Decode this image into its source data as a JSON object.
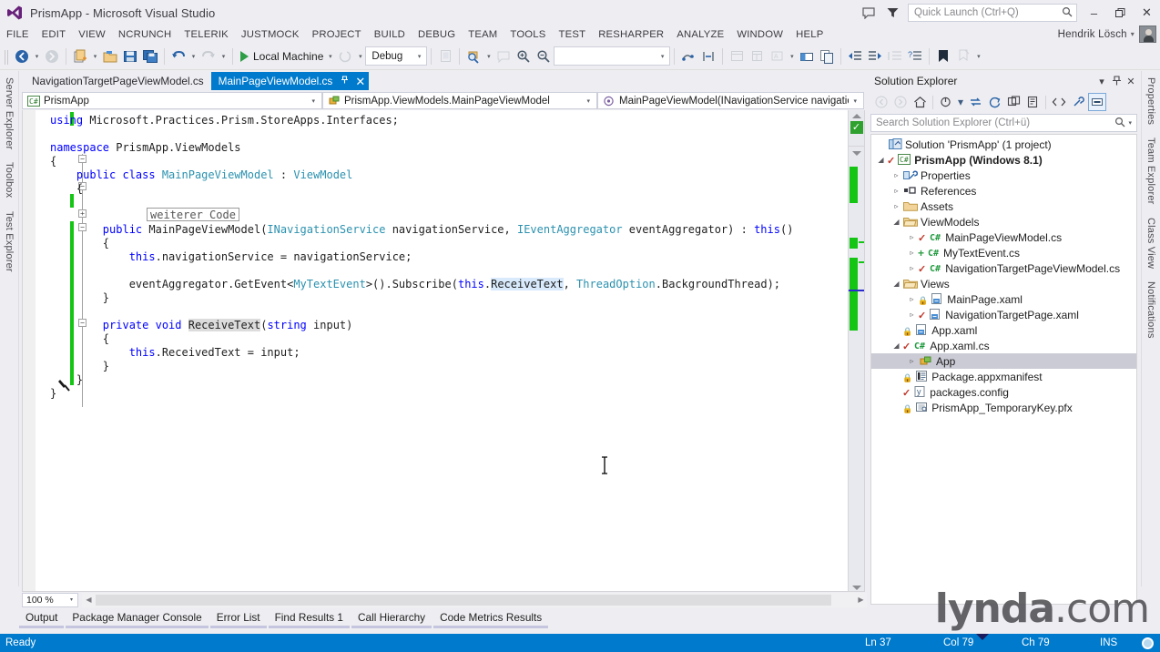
{
  "window": {
    "title": "PrismApp - Microsoft Visual Studio",
    "logo_icon": "visual-studio-logo",
    "minimize_label": "–",
    "maximize_label": "❐",
    "close_label": "✕",
    "feedback_icon": "feedback-icon",
    "filter_icon": "filter-icon"
  },
  "quick_launch": {
    "placeholder": "Quick Launch (Ctrl+Q)",
    "icon": "search-icon"
  },
  "menubar": {
    "items": [
      "FILE",
      "EDIT",
      "VIEW",
      "NCRUNCH",
      "TELERIK",
      "JUSTMOCK",
      "PROJECT",
      "BUILD",
      "DEBUG",
      "TEAM",
      "TOOLS",
      "TEST",
      "RESHARPER",
      "ANALYZE",
      "WINDOW",
      "HELP"
    ],
    "user_name": "Hendrik Lösch",
    "user_caret": "▾",
    "avatar_icon": "user-avatar"
  },
  "toolbar": {
    "navigate_back_icon": "navigate-back-icon",
    "navigate_forward_icon": "navigate-forward-icon",
    "new_project_icon": "new-project-icon",
    "open_file_icon": "open-file-icon",
    "save_icon": "save-icon",
    "save_all_icon": "save-all-icon",
    "undo_icon": "undo-icon",
    "redo_icon": "redo-icon",
    "start_label": "Local Machine",
    "start_icon": "run-play-icon",
    "stop_icon": "stop-icon",
    "config_value": "Debug",
    "find_icon": "find-icon",
    "zoom_in_icon": "zoom-in-icon",
    "zoom_out_icon": "zoom-out-icon",
    "blank_combo_value": "",
    "comment_icon": "comment-icon",
    "uncomment_icon": "uncomment-icon",
    "indent_icon": "indent-icon",
    "outdent_icon": "outdent-icon",
    "bookmark_icon": "bookmark-icon",
    "toolbox_icon": "toolbox-icon",
    "properties_window_icon": "properties-window-icon",
    "solution_explorer_icon": "solution-explorer-icon",
    "object_browser_icon": "object-browser-icon",
    "caret": "▾"
  },
  "left_dock": {
    "tabs": [
      "Server Explorer",
      "Toolbox",
      "Test Explorer"
    ]
  },
  "right_dock": {
    "tabs": [
      "Properties",
      "Team Explorer",
      "Class View",
      "Notifications"
    ]
  },
  "editor": {
    "tabs": [
      {
        "label": "NavigationTargetPageViewModel.cs",
        "active": false
      },
      {
        "label": "MainPageViewModel.cs",
        "active": true,
        "pin_icon": "pin-icon",
        "pin_glyph": "–❉",
        "close_glyph": "✕"
      }
    ],
    "navbar": {
      "project": "PrismApp",
      "project_icon": "csharp-project-icon",
      "type": "PrismApp.ViewModels.MainPageViewModel",
      "type_icon": "class-icon",
      "member": "MainPageViewModel(INavigationService navigationSer",
      "member_icon": "method-icon",
      "caret": "▾"
    },
    "outline_box_text": "weiterer Code",
    "zoom_level": "100 %",
    "zoom_caret": "▾",
    "code_lines": [
      {
        "indent": 0,
        "segments": [
          {
            "t": "using",
            "c": "k"
          },
          {
            "t": " Microsoft.Practices.Prism.StoreApps.Interfaces;",
            "c": "plain"
          }
        ]
      },
      {
        "indent": 0,
        "segments": []
      },
      {
        "indent": 0,
        "segments": [
          {
            "t": "namespace",
            "c": "k"
          },
          {
            "t": " PrismApp.ViewModels",
            "c": "plain"
          }
        ]
      },
      {
        "indent": 0,
        "segments": [
          {
            "t": "{",
            "c": "plain"
          }
        ]
      },
      {
        "indent": 1,
        "segments": [
          {
            "t": "public class ",
            "c": "k"
          },
          {
            "t": "MainPageViewModel",
            "c": "t"
          },
          {
            "t": " : ",
            "c": "plain"
          },
          {
            "t": "ViewModel",
            "c": "t"
          }
        ]
      },
      {
        "indent": 1,
        "segments": [
          {
            "t": "{",
            "c": "plain"
          }
        ]
      },
      {
        "indent": 2,
        "segments": []
      },
      {
        "indent": 2,
        "segments": []
      },
      {
        "indent": 2,
        "segments": [
          {
            "t": "public ",
            "c": "k"
          },
          {
            "t": "MainPageViewModel(",
            "c": "plain"
          },
          {
            "t": "INavigationService",
            "c": "t"
          },
          {
            "t": " navigationService, ",
            "c": "plain"
          },
          {
            "t": "IEventAggregator",
            "c": "t"
          },
          {
            "t": " eventAggregator) : ",
            "c": "plain"
          },
          {
            "t": "this",
            "c": "k"
          },
          {
            "t": "()",
            "c": "plain"
          }
        ]
      },
      {
        "indent": 2,
        "segments": [
          {
            "t": "{",
            "c": "plain"
          }
        ]
      },
      {
        "indent": 3,
        "segments": [
          {
            "t": "this",
            "c": "k"
          },
          {
            "t": ".navigationService = navigationService;",
            "c": "plain"
          }
        ]
      },
      {
        "indent": 3,
        "segments": []
      },
      {
        "indent": 3,
        "segments": [
          {
            "t": "eventAggregator.GetEvent<",
            "c": "plain"
          },
          {
            "t": "MyTextEvent",
            "c": "t"
          },
          {
            "t": ">().Subscribe(",
            "c": "plain"
          },
          {
            "t": "this",
            "c": "k"
          },
          {
            "t": ".",
            "c": "plain"
          },
          {
            "t": "ReceiveText",
            "c": "plain hl"
          },
          {
            "t": ", ",
            "c": "plain"
          },
          {
            "t": "ThreadOption",
            "c": "t"
          },
          {
            "t": ".BackgroundThread);",
            "c": "plain"
          }
        ]
      },
      {
        "indent": 2,
        "segments": [
          {
            "t": "}",
            "c": "plain"
          }
        ]
      },
      {
        "indent": 2,
        "segments": []
      },
      {
        "indent": 2,
        "segments": [
          {
            "t": "private void ",
            "c": "k"
          },
          {
            "t": "ReceiveText",
            "c": "plain hl2"
          },
          {
            "t": "(",
            "c": "plain"
          },
          {
            "t": "string",
            "c": "k"
          },
          {
            "t": " input)",
            "c": "plain"
          }
        ]
      },
      {
        "indent": 2,
        "segments": [
          {
            "t": "{",
            "c": "plain"
          }
        ]
      },
      {
        "indent": 3,
        "segments": [
          {
            "t": "this",
            "c": "k"
          },
          {
            "t": ".ReceivedText = input;",
            "c": "plain"
          }
        ]
      },
      {
        "indent": 2,
        "segments": [
          {
            "t": "}",
            "c": "plain"
          }
        ]
      },
      {
        "indent": 1,
        "segments": [
          {
            "t": "}",
            "c": "plain"
          }
        ]
      },
      {
        "indent": 0,
        "segments": [
          {
            "t": "}",
            "c": "plain"
          }
        ]
      }
    ]
  },
  "bottom_tabs": [
    "Output",
    "Package Manager Console",
    "Error List",
    "Find Results 1",
    "Call Hierarchy",
    "Code Metrics Results"
  ],
  "solution_explorer": {
    "title": "Solution Explorer",
    "dropdown_icon": "chevron-down-icon",
    "pin_icon": "pin-icon",
    "close_icon": "close-icon",
    "toolbar_icons": [
      "back-icon",
      "forward-icon",
      "home-icon",
      "pending-changes-icon",
      "sync-with-active-document-icon",
      "refresh-icon",
      "collapse-all-icon",
      "show-all-files-icon",
      "view-code-icon",
      "properties-icon",
      "preview-selected-items-icon"
    ],
    "search_placeholder": "Search Solution Explorer (Ctrl+ü)",
    "search_icon": "search-icon",
    "tree": [
      {
        "depth": 0,
        "expander": "",
        "icon": "solution-icon",
        "label": "Solution 'PrismApp' (1 project)",
        "bold": false,
        "status": "",
        "selected": false
      },
      {
        "depth": 0,
        "expander": "◢",
        "icon": "csharp-project-icon",
        "label": "PrismApp (Windows 8.1)",
        "bold": true,
        "status": "check",
        "selected": false
      },
      {
        "depth": 1,
        "expander": "▹",
        "icon": "properties-folder-icon",
        "label": "Properties",
        "bold": false,
        "status": "",
        "selected": false
      },
      {
        "depth": 1,
        "expander": "▹",
        "icon": "references-icon",
        "label": "References",
        "bold": false,
        "status": "",
        "selected": false
      },
      {
        "depth": 1,
        "expander": "▹",
        "icon": "folder-icon",
        "label": "Assets",
        "bold": false,
        "status": "",
        "selected": false
      },
      {
        "depth": 1,
        "expander": "◢",
        "icon": "folder-open-icon",
        "label": "ViewModels",
        "bold": false,
        "status": "",
        "selected": false
      },
      {
        "depth": 2,
        "expander": "▹",
        "icon": "csharp-file-icon",
        "label": "MainPageViewModel.cs",
        "bold": false,
        "status": "check",
        "selected": false
      },
      {
        "depth": 2,
        "expander": "▹",
        "icon": "csharp-file-icon",
        "label": "MyTextEvent.cs",
        "bold": false,
        "status": "plus",
        "selected": false
      },
      {
        "depth": 2,
        "expander": "▹",
        "icon": "csharp-file-icon",
        "label": "NavigationTargetPageViewModel.cs",
        "bold": false,
        "status": "check",
        "selected": false
      },
      {
        "depth": 1,
        "expander": "◢",
        "icon": "folder-open-icon",
        "label": "Views",
        "bold": false,
        "status": "",
        "selected": false
      },
      {
        "depth": 2,
        "expander": "▹",
        "icon": "xaml-file-icon",
        "label": "MainPage.xaml",
        "bold": false,
        "status": "lock",
        "selected": false
      },
      {
        "depth": 2,
        "expander": "▹",
        "icon": "xaml-file-icon",
        "label": "NavigationTargetPage.xaml",
        "bold": false,
        "status": "check",
        "selected": false
      },
      {
        "depth": 1,
        "expander": "",
        "icon": "xaml-file-icon",
        "label": "App.xaml",
        "bold": false,
        "status": "lock",
        "selected": false
      },
      {
        "depth": 1,
        "expander": "◢",
        "icon": "csharp-file-icon",
        "label": "App.xaml.cs",
        "bold": false,
        "status": "check",
        "selected": false
      },
      {
        "depth": 2,
        "expander": "▹",
        "icon": "class-icon",
        "label": "App",
        "bold": false,
        "status": "",
        "selected": true
      },
      {
        "depth": 1,
        "expander": "",
        "icon": "manifest-icon",
        "label": "Package.appxmanifest",
        "bold": false,
        "status": "lock",
        "selected": false
      },
      {
        "depth": 1,
        "expander": "",
        "icon": "config-file-icon",
        "label": "packages.config",
        "bold": false,
        "status": "check2",
        "selected": false
      },
      {
        "depth": 1,
        "expander": "",
        "icon": "certificate-icon",
        "label": "PrismApp_TemporaryKey.pfx",
        "bold": false,
        "status": "lock",
        "selected": false
      }
    ]
  },
  "watermark": {
    "brand": "lynda",
    "suffix": ".com"
  },
  "statusbar": {
    "state": "Ready",
    "line": "Ln 37",
    "column": "Col 79",
    "char": "Ch 79",
    "insert_mode": "INS",
    "record_icon": "record-indicator"
  }
}
